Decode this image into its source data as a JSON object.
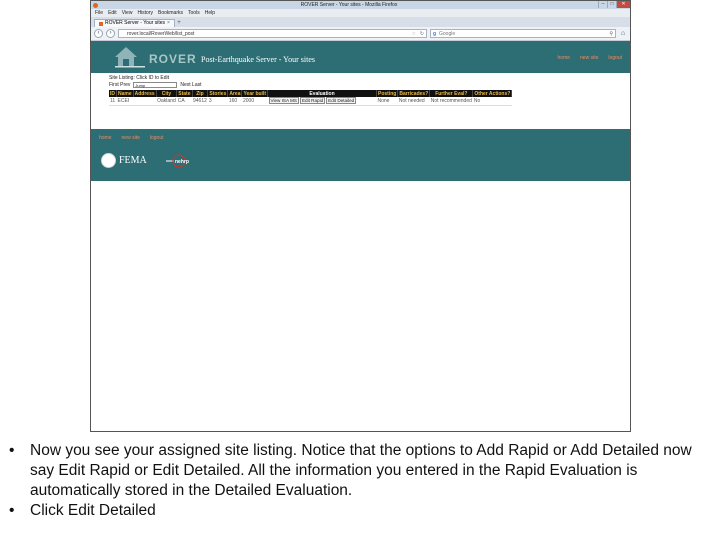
{
  "browser": {
    "window_title": "ROVER Server - Your sites - Mozilla Firefox",
    "menu": [
      "File",
      "Edit",
      "View",
      "History",
      "Bookmarks",
      "Tools",
      "Help"
    ],
    "tab_label": "ROVER Server - Your sites",
    "url": "rover.local/RoverWeb/list_post",
    "search_placeholder": "Google"
  },
  "app": {
    "brand": "ROVER",
    "tagline": "Post-Earthquake Server - Your sites",
    "top_links": [
      "home",
      "new site",
      "logout"
    ],
    "site_listing": {
      "title": "Site Listing: Click ID to Edit",
      "nav_first_prev": "First Prev",
      "jump_value": "Jump",
      "nav_next_last": "Next Last",
      "columns": [
        "ID",
        "Name",
        "Address",
        "City",
        "State",
        "Zip",
        "Stories",
        "Area",
        "Year built",
        "Evaluation",
        "Posting",
        "Barricades?",
        "Further Eval?",
        "Other Actions?"
      ],
      "rows": [
        {
          "id": "11",
          "name": "ECEI",
          "address": "",
          "city": "Oakland",
          "state": "CA",
          "zip": "94612",
          "stories": "3",
          "area": "160",
          "year_built": "2000",
          "evaluation_buttons": [
            "View ISA MS",
            "Edit Rapid",
            "Edit Detailed"
          ],
          "posting": "None",
          "barricades": "Not needed",
          "further_eval": "Not recommended",
          "other_actions": "No"
        }
      ]
    },
    "footer_links": [
      "home",
      "new site",
      "logout"
    ],
    "footer_logos": [
      "FEMA",
      "nehrp"
    ]
  },
  "notes": [
    "Now you see your assigned site listing. Notice that the options to Add Rapid or Add Detailed now say Edit Rapid or Edit Detailed. All the information you entered in the Rapid Evaluation is automatically stored in the Detailed Evaluation.",
    "Click Edit Detailed"
  ],
  "colors": {
    "header_teal": "#2d6e74",
    "link_orange": "#f08a5d",
    "table_header_black": "#111111",
    "table_header_gold": "#e8b84a"
  }
}
